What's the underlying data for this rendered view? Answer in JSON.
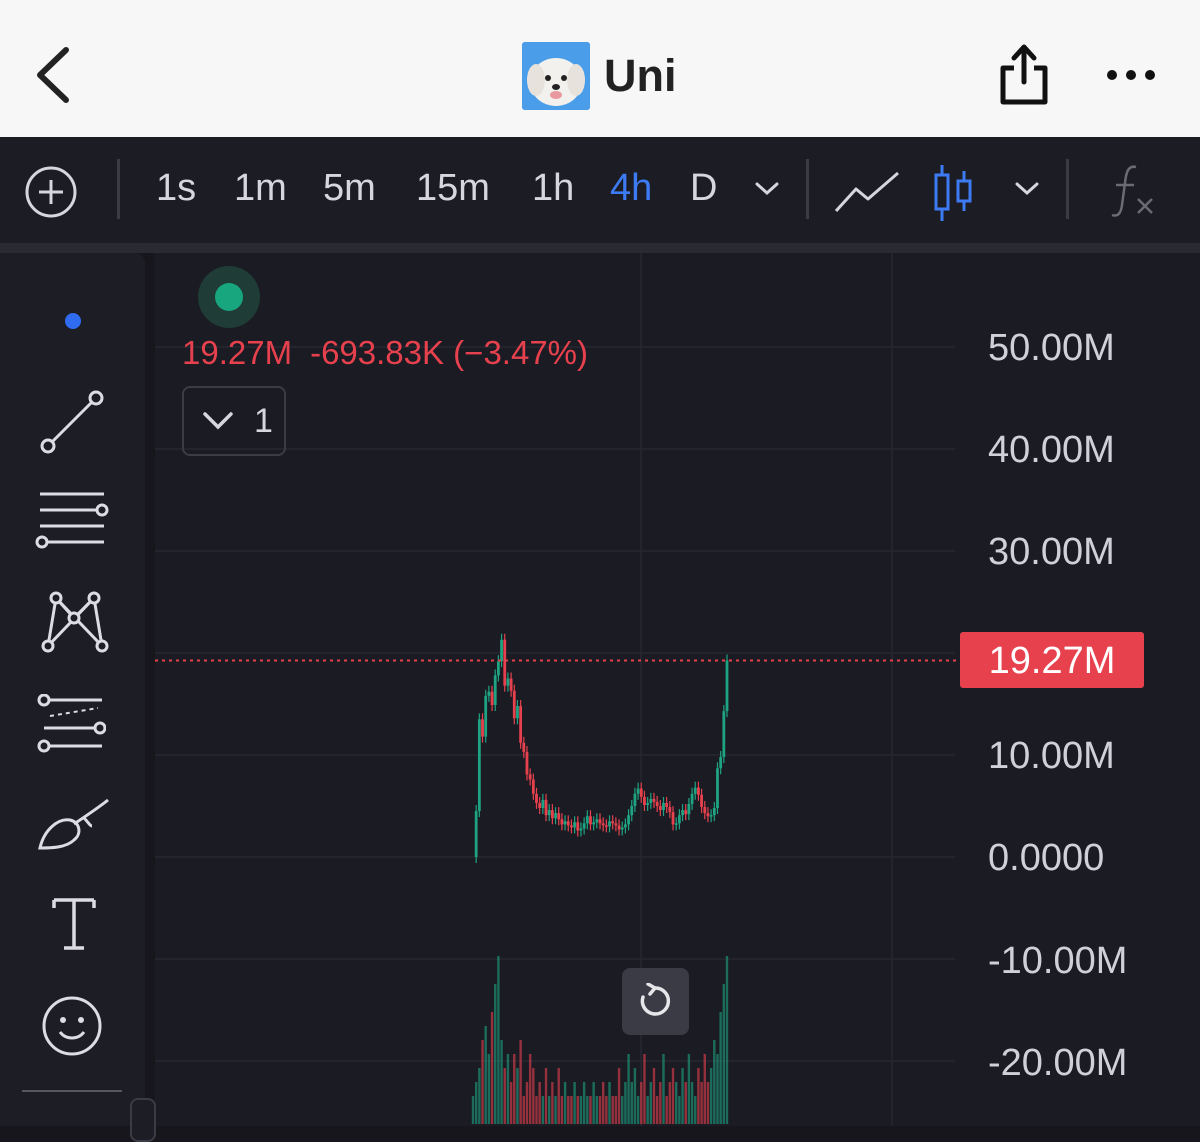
{
  "header": {
    "title": "Uni"
  },
  "toolbar": {
    "timeframes": [
      "1s",
      "1m",
      "5m",
      "15m",
      "1h",
      "4h",
      "D"
    ],
    "active_timeframe": "4h",
    "accent_color": "#3d7bf5"
  },
  "left_tools": [
    "dot-indicator",
    "trend-line-icon",
    "horizontal-lines-icon",
    "pattern-icon",
    "fib-levels-icon",
    "brush-icon",
    "text-icon",
    "emoji-icon"
  ],
  "legend": {
    "price": "19.27M",
    "change": "-693.83K (−3.47%)",
    "collapse_count": "1"
  },
  "price_axis": {
    "labels": [
      "50.00M",
      "40.00M",
      "30.00M",
      "19.27M",
      "10.00M",
      "0.0000",
      "-10.00M",
      "-20.00M"
    ]
  },
  "current_price_label": "19.27M",
  "colors": {
    "up": "#1ea482",
    "down": "#e8414e",
    "background": "#1a1b23"
  },
  "chart_data": {
    "type": "candlestick",
    "ylim": [
      -20000000,
      50000000
    ],
    "last_value": 19270000,
    "series": [
      {
        "name": "",
        "values": [
          0,
          4500000,
          13500000,
          11800000,
          15800000,
          16200000,
          14900000,
          17800000,
          19200000,
          21300000,
          16800000,
          17500000,
          16300000,
          13600000,
          14800000,
          11200000,
          10300000,
          8100000,
          7600000,
          6200000,
          5300000,
          4800000,
          5600000,
          4100000,
          4600000,
          3800000,
          4300000,
          3700000,
          3200000,
          3500000,
          3100000,
          2900000,
          3400000,
          2600000,
          2800000,
          3300000,
          4000000,
          3200000,
          3400000,
          3700000,
          3300000,
          3100000,
          3000000,
          3500000,
          3300000,
          3100000,
          2700000,
          2900000,
          3200000,
          4100000,
          5000000,
          6200000,
          6700000,
          5900000,
          5100000,
          5300000,
          5700000,
          5400000,
          5000000,
          4600000,
          5300000,
          4900000,
          4400000,
          3200000,
          3300000,
          4100000,
          4600000,
          4200000,
          5200000,
          6200000,
          6800000,
          6100000,
          4900000,
          4300000,
          4000000,
          4100000,
          4800000,
          8700000,
          9800000,
          14300000,
          19270000
        ]
      }
    ],
    "volume": [
      2,
      3,
      4,
      6,
      7,
      5,
      8,
      10,
      12,
      6,
      4,
      5,
      3,
      5,
      4,
      6,
      2,
      3,
      5,
      4,
      2,
      3,
      2,
      4,
      2,
      3,
      2,
      4,
      2,
      3,
      2,
      2,
      3,
      2,
      2,
      3,
      2,
      2,
      3,
      2,
      2,
      3,
      2,
      3,
      2,
      2,
      4,
      2,
      3,
      5,
      3,
      4,
      2,
      3,
      5,
      2,
      3,
      4,
      2,
      3,
      5,
      2,
      3,
      4,
      3,
      2,
      4,
      3,
      5,
      3,
      2,
      4,
      3,
      5,
      3,
      4,
      6,
      5,
      8,
      10,
      12
    ]
  }
}
